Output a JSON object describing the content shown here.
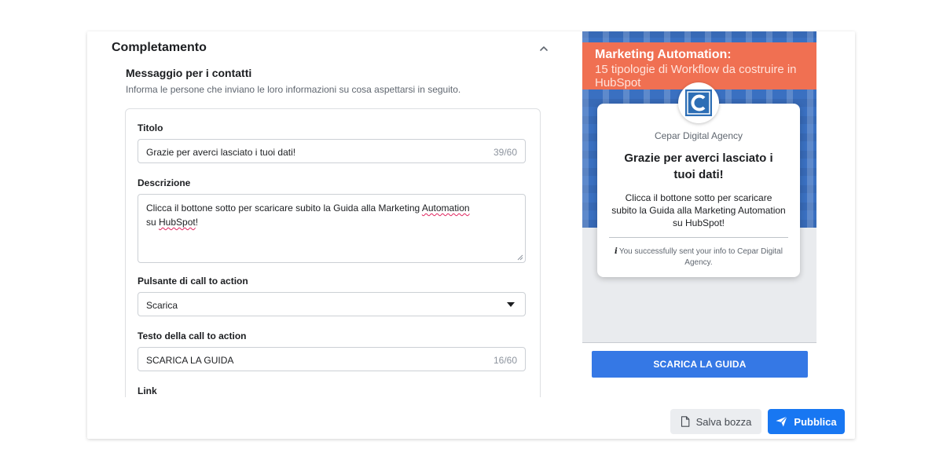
{
  "section": {
    "title": "Completamento",
    "subtitle": "Messaggio per i contatti",
    "description": "Informa le persone che inviano le loro informazioni su cosa aspettarsi in seguito."
  },
  "fields": {
    "title": {
      "label": "Titolo",
      "value": "Grazie per averci lasciato i tuoi dati!",
      "counter": "39/60"
    },
    "description": {
      "label": "Descrizione",
      "value_part1": "Clicca il bottone sotto per scaricare subito la Guida alla Marketing ",
      "value_word1": "Automation",
      "value_part2": "su ",
      "value_word2": "HubSpot",
      "value_part3": "!"
    },
    "cta_button": {
      "label": "Pulsante di call to action",
      "selected": "Scarica"
    },
    "cta_text": {
      "label": "Testo della call to action",
      "value": "SCARICA LA GUIDA",
      "counter": "16/60"
    },
    "link": {
      "label": "Link"
    }
  },
  "preview": {
    "banner_title": "Marketing Automation:",
    "banner_subtitle": "15 tipologie di Workflow da costruire in HubSpot",
    "company": "Cepar Digital Agency",
    "title": "Grazie per averci lasciato i tuoi dati!",
    "description": "Clicca il bottone sotto per scaricare subito la Guida alla Marketing Automation su HubSpot!",
    "note_icon": "i",
    "note": "You successfully sent your info to Cepar Digital Agency.",
    "cta": "SCARICA LA GUIDA"
  },
  "footer": {
    "draft_label": "Salva bozza",
    "publish_label": "Pubblica"
  },
  "icons": {
    "collapse": "chevron-up-icon",
    "dropdown": "caret-down-icon",
    "logo": "cepar-logo",
    "draft": "document-icon",
    "publish": "paper-plane-icon"
  },
  "colors": {
    "primary": "#1877f2",
    "preview_cta": "#3578e5",
    "banner": "#f07052",
    "preview_bg": "#3a70c1",
    "logo": "#2d6eb5"
  }
}
